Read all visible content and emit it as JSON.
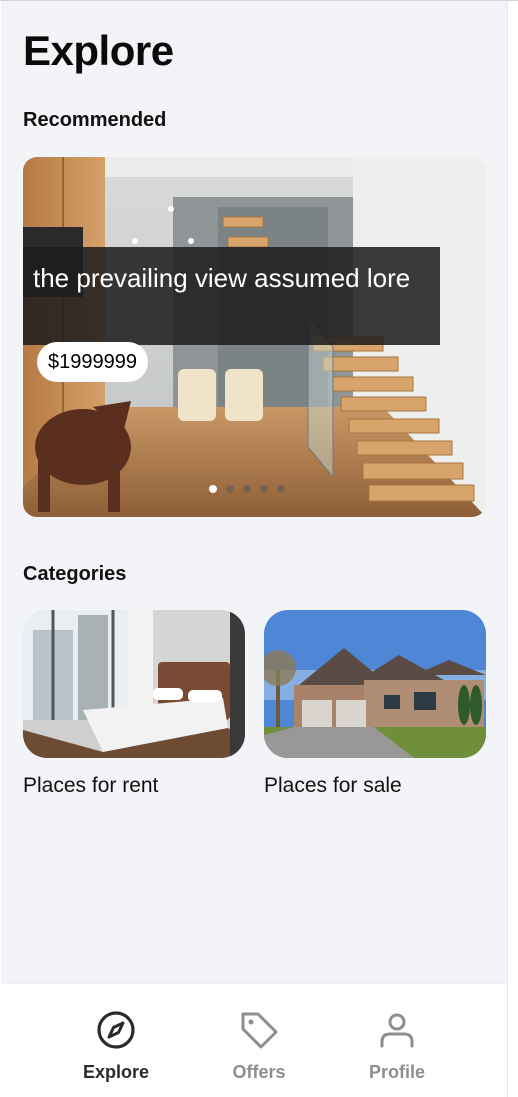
{
  "page": {
    "title": "Explore",
    "recommended_heading": "Recommended",
    "categories_heading": "Categories"
  },
  "recommended": {
    "caption": "the prevailing view assumed lore",
    "price": "$1999999",
    "image": "modern-staircase-living-room-photo",
    "slide_count": 5,
    "active_slide": 1
  },
  "categories": [
    {
      "label": "Places for rent",
      "image": "bedroom-photo"
    },
    {
      "label": "Places for sale",
      "image": "suburban-house-photo"
    }
  ],
  "tabbar": {
    "items": [
      {
        "label": "Explore",
        "icon": "compass-icon",
        "active": true
      },
      {
        "label": "Offers",
        "icon": "tag-icon",
        "active": false
      },
      {
        "label": "Profile",
        "icon": "user-icon",
        "active": false
      }
    ]
  },
  "colors": {
    "background": "#f3f4f8",
    "active_tab": "#2b2b2b",
    "inactive_tab": "#8e8e8e",
    "caption_overlay": "#1c1c1c"
  }
}
